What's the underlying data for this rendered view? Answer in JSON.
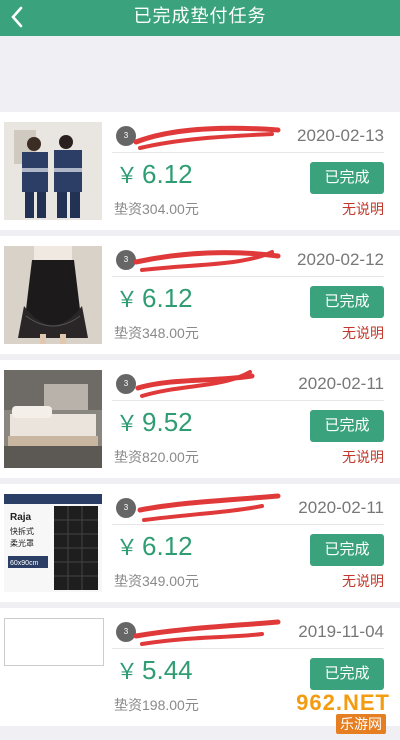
{
  "header": {
    "title": "已完成垫付任务",
    "back_icon": "chevron-left-icon"
  },
  "colors": {
    "brand": "#3aa37e",
    "price": "#2f9c73",
    "note": "#c0392b"
  },
  "tasks": [
    {
      "date": "2020-02-13",
      "currency": "￥",
      "price": "6.12",
      "status": "已完成",
      "advance": "垫资304.00元",
      "note": "无说明",
      "thumb": "uniform-photo"
    },
    {
      "date": "2020-02-12",
      "currency": "￥",
      "price": "6.12",
      "status": "已完成",
      "advance": "垫资348.00元",
      "note": "无说明",
      "thumb": "skirt-photo"
    },
    {
      "date": "2020-02-11",
      "currency": "￥",
      "price": "9.52",
      "status": "已完成",
      "advance": "垫资820.00元",
      "note": "无说明",
      "thumb": "bed-photo"
    },
    {
      "date": "2020-02-11",
      "currency": "￥",
      "price": "6.12",
      "status": "已完成",
      "advance": "垫资349.00元",
      "note": "无说明",
      "thumb": "softbox-photo",
      "thumb_text": [
        "Raja",
        "快拆式",
        "柔光罩",
        "60x90cm"
      ]
    },
    {
      "date": "2019-11-04",
      "currency": "￥",
      "price": "5.44",
      "status": "已完成",
      "advance": "垫资198.00元",
      "note": "",
      "thumb": "broken-image"
    }
  ],
  "watermark": {
    "number": "962.NET",
    "subtitle": "乐游网"
  }
}
